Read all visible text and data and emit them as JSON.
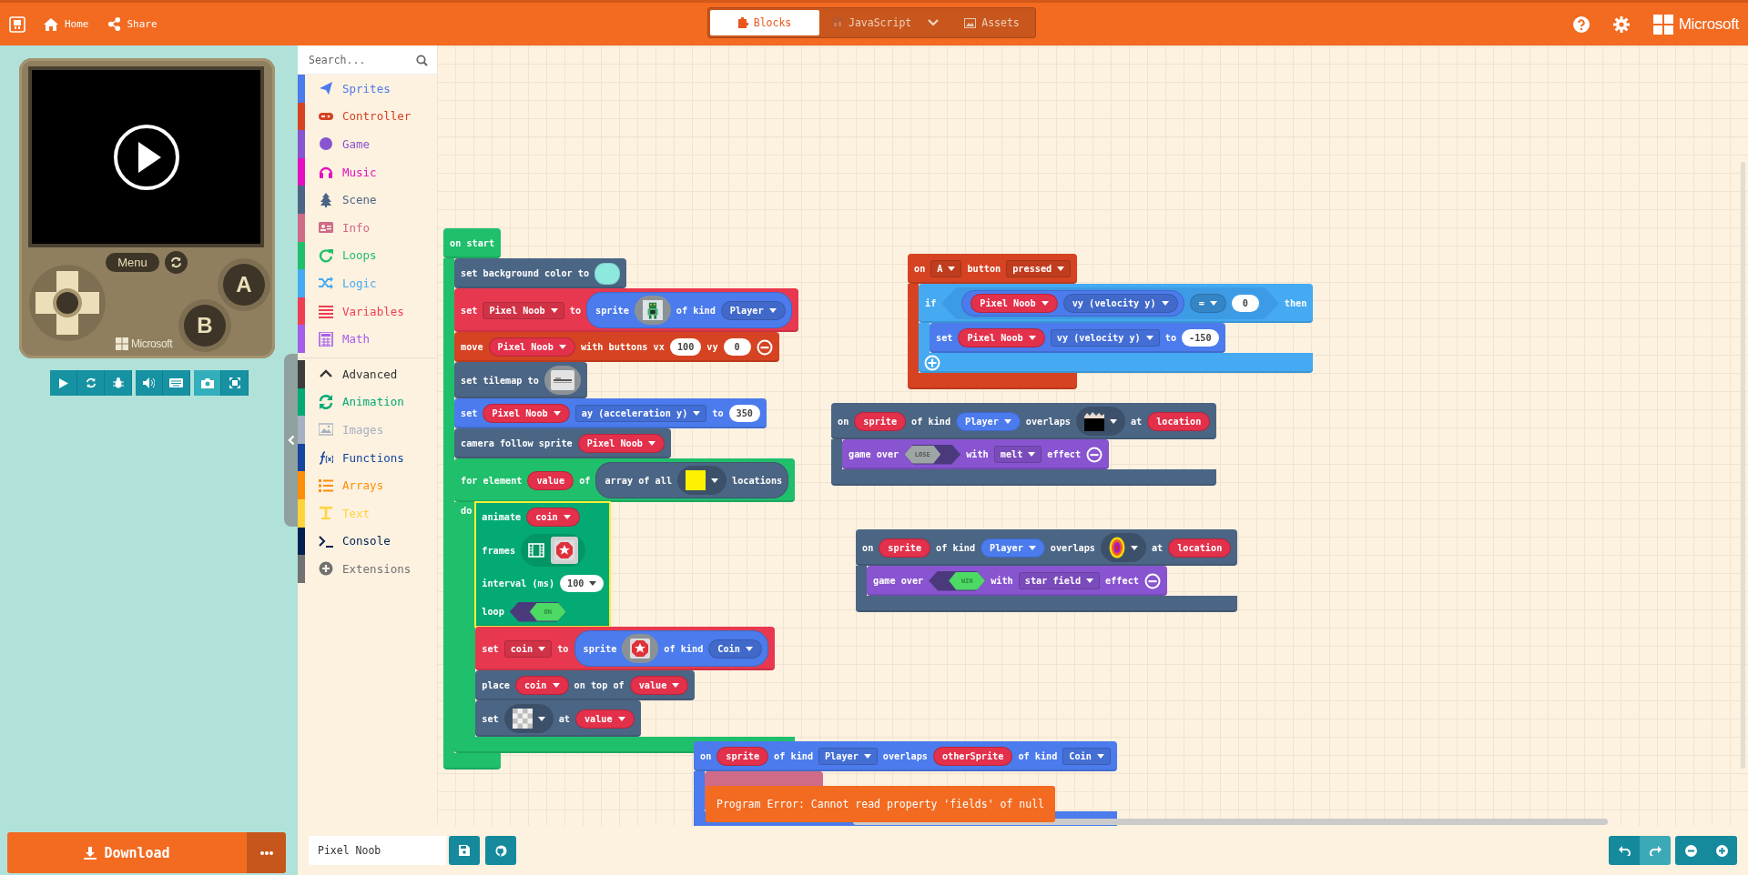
{
  "header": {
    "links": [
      {
        "kind": "home",
        "label": "Home"
      },
      {
        "kind": "share",
        "label": "Share"
      }
    ],
    "tabs": [
      {
        "kind": "blocks",
        "label": "Blocks",
        "selected": true
      },
      {
        "kind": "javascript",
        "label": "JavaScript",
        "selected": false
      },
      {
        "kind": "assets",
        "label": "Assets",
        "selected": false
      }
    ],
    "brand": "Microsoft"
  },
  "simulator": {
    "menu_label": "Menu",
    "buttons": [
      {
        "label": "A"
      },
      {
        "label": "B"
      }
    ],
    "brand": "Microsoft",
    "download_label": "Download"
  },
  "toolbox": {
    "search_placeholder": "Search...",
    "categories": [
      {
        "kind": "sprites",
        "label": "Sprites",
        "color": "#4b7bec"
      },
      {
        "kind": "controller",
        "label": "Controller",
        "color": "#d54322"
      },
      {
        "kind": "game",
        "label": "Game",
        "color": "#8854d0"
      },
      {
        "kind": "music",
        "label": "Music",
        "color": "#e30fc0"
      },
      {
        "kind": "scene",
        "label": "Scene",
        "color": "#4b6584"
      },
      {
        "kind": "info",
        "label": "Info",
        "color": "#cf6a87"
      },
      {
        "kind": "loops",
        "label": "Loops",
        "color": "#20bf6b"
      },
      {
        "kind": "logic",
        "label": "Logic",
        "color": "#45aaf2"
      },
      {
        "kind": "variables",
        "label": "Variables",
        "color": "#ef3e53"
      },
      {
        "kind": "math",
        "label": "Math",
        "color": "#a55eea"
      }
    ],
    "advanced": {
      "label": "Advanced",
      "expanded": true,
      "color": "#3c3c3c"
    },
    "advanced_categories": [
      {
        "kind": "animation",
        "label": "Animation",
        "color": "#03aa74"
      },
      {
        "kind": "images",
        "label": "Images",
        "color": "#a5b1c2"
      },
      {
        "kind": "functions",
        "label": "Functions",
        "color": "#1446a0"
      },
      {
        "kind": "arrays",
        "label": "Arrays",
        "color": "#ff8f08"
      },
      {
        "kind": "text",
        "label": "Text",
        "color": "#ffd43a"
      },
      {
        "kind": "console",
        "label": "Console",
        "color": "#002050"
      },
      {
        "kind": "extensions",
        "label": "Extensions",
        "color": "#717171"
      }
    ]
  },
  "workspace": {
    "stacks": [
      {
        "kind": "loops",
        "selected": false,
        "rows": [
          [
            {
              "kind": "label",
              "text": "on start"
            }
          ]
        ],
        "body": [
          {
            "kind": "scene",
            "selected": false,
            "rows": [
              [
                {
                  "kind": "label",
                  "text": "set background color to"
                },
                {
                  "kind": "color",
                  "color": "#8de8de"
                }
              ]
            ]
          },
          {
            "kind": "variables",
            "selected": false,
            "rows": [
              [
                {
                  "kind": "label",
                  "text": "set"
                },
                {
                  "kind": "field",
                  "text": "Pixel Noob"
                },
                {
                  "kind": "label",
                  "text": "to"
                },
                {
                  "kind": "reporter",
                  "color": "#4b7bec",
                  "parts": [
                    {
                      "kind": "label",
                      "text": "sprite"
                    },
                    {
                      "kind": "robot-image"
                    },
                    {
                      "kind": "label",
                      "text": "of kind"
                    },
                    {
                      "kind": "field",
                      "text": "Player"
                    }
                  ]
                }
              ]
            ]
          },
          {
            "kind": "controller",
            "selected": false,
            "rows": [
              [
                {
                  "kind": "label",
                  "text": "move"
                },
                {
                  "kind": "var",
                  "text": "Pixel Noob"
                },
                {
                  "kind": "label",
                  "text": "with buttons vx"
                },
                {
                  "kind": "num",
                  "text": "100"
                },
                {
                  "kind": "label",
                  "text": "vy"
                },
                {
                  "kind": "num",
                  "text": "0"
                },
                {
                  "kind": "remove"
                }
              ]
            ]
          },
          {
            "kind": "scene",
            "selected": false,
            "rows": [
              [
                {
                  "kind": "label",
                  "text": "set tilemap to"
                },
                {
                  "kind": "tilemap-image"
                }
              ]
            ]
          },
          {
            "kind": "sprites",
            "selected": false,
            "rows": [
              [
                {
                  "kind": "label",
                  "text": "set"
                },
                {
                  "kind": "var",
                  "text": "Pixel Noob"
                },
                {
                  "kind": "field",
                  "text": "ay (acceleration y)"
                },
                {
                  "kind": "label",
                  "text": "to"
                },
                {
                  "kind": "num",
                  "text": "350"
                }
              ]
            ]
          },
          {
            "kind": "scene",
            "selected": false,
            "rows": [
              [
                {
                  "kind": "label",
                  "text": "camera follow sprite"
                },
                {
                  "kind": "var",
                  "text": "Pixel Noob"
                }
              ]
            ]
          },
          {
            "kind": "loops",
            "selected": false,
            "rows": [
              [
                {
                  "kind": "label",
                  "text": "for element"
                },
                {
                  "kind": "arg",
                  "text": "value"
                },
                {
                  "kind": "label",
                  "text": "of"
                },
                {
                  "kind": "reporter",
                  "color": "#4b6584",
                  "parts": [
                    {
                      "kind": "label",
                      "text": "array of all"
                    },
                    {
                      "kind": "yellow-picker"
                    },
                    {
                      "kind": "label",
                      "text": "locations"
                    }
                  ]
                }
              ]
            ],
            "arm_label": "do",
            "body": [
              {
                "kind": "animation",
                "selected": true,
                "rows": [
                  [
                    {
                      "kind": "label",
                      "text": "animate"
                    },
                    {
                      "kind": "var",
                      "text": "coin"
                    }
                  ],
                  [
                    {
                      "kind": "label",
                      "text": "frames"
                    },
                    {
                      "kind": "coin-frames"
                    }
                  ],
                  [
                    {
                      "kind": "label",
                      "text": "interval (ms)"
                    },
                    {
                      "kind": "numdrop",
                      "text": "100"
                    }
                  ],
                  [
                    {
                      "kind": "label",
                      "text": "loop"
                    },
                    {
                      "kind": "toggle",
                      "text": "ON",
                      "on": true
                    }
                  ]
                ]
              },
              {
                "kind": "variables",
                "selected": false,
                "rows": [
                  [
                    {
                      "kind": "label",
                      "text": "set"
                    },
                    {
                      "kind": "field",
                      "text": "coin"
                    },
                    {
                      "kind": "label",
                      "text": "to"
                    },
                    {
                      "kind": "reporter",
                      "color": "#4b7bec",
                      "parts": [
                        {
                          "kind": "label",
                          "text": "sprite"
                        },
                        {
                          "kind": "coin-image"
                        },
                        {
                          "kind": "label",
                          "text": "of kind"
                        },
                        {
                          "kind": "field",
                          "text": "Coin"
                        }
                      ]
                    }
                  ]
                ]
              },
              {
                "kind": "scene",
                "selected": false,
                "rows": [
                  [
                    {
                      "kind": "label",
                      "text": "place"
                    },
                    {
                      "kind": "var",
                      "text": "coin"
                    },
                    {
                      "kind": "label",
                      "text": "on top of"
                    },
                    {
                      "kind": "var",
                      "text": "value"
                    }
                  ]
                ]
              },
              {
                "kind": "scene",
                "selected": false,
                "rows": [
                  [
                    {
                      "kind": "label",
                      "text": "set"
                    },
                    {
                      "kind": "checker-picker"
                    },
                    {
                      "kind": "label",
                      "text": "at"
                    },
                    {
                      "kind": "var",
                      "text": "value"
                    }
                  ]
                ]
              }
            ]
          }
        ]
      },
      {
        "kind": "controller",
        "selected": false,
        "rows": [
          [
            {
              "kind": "label",
              "text": "on"
            },
            {
              "kind": "field",
              "text": "A"
            },
            {
              "kind": "label",
              "text": "button"
            },
            {
              "kind": "field",
              "text": "pressed"
            }
          ]
        ],
        "body": [
          {
            "kind": "logic",
            "selected": false,
            "rows": [
              [
                {
                  "kind": "label",
                  "text": "if"
                },
                {
                  "kind": "hex",
                  "parts": [
                    {
                      "kind": "reporter",
                      "color": "#4b7bec",
                      "parts": [
                        {
                          "kind": "var",
                          "text": "Pixel Noob"
                        },
                        {
                          "kind": "field",
                          "text": "vy (velocity y)"
                        }
                      ]
                    },
                    {
                      "kind": "field",
                      "text": "="
                    },
                    {
                      "kind": "num",
                      "text": "0"
                    }
                  ]
                },
                {
                  "kind": "label",
                  "text": "then"
                }
              ]
            ],
            "body": [
              {
                "kind": "sprites",
                "selected": false,
                "rows": [
                  [
                    {
                      "kind": "label",
                      "text": "set"
                    },
                    {
                      "kind": "var",
                      "text": "Pixel Noob"
                    },
                    {
                      "kind": "field",
                      "text": "vy (velocity y)"
                    },
                    {
                      "kind": "label",
                      "text": "to"
                    },
                    {
                      "kind": "num",
                      "text": "-150"
                    }
                  ]
                ]
              }
            ],
            "footer": [
              {
                "kind": "add"
              }
            ]
          }
        ]
      },
      {
        "kind": "scene",
        "selected": false,
        "rows": [
          [
            {
              "kind": "label",
              "text": "on"
            },
            {
              "kind": "arg",
              "text": "sprite"
            },
            {
              "kind": "label",
              "text": "of kind"
            },
            {
              "kind": "field",
              "text": "Player",
              "color": "#4b7bec"
            },
            {
              "kind": "label",
              "text": "overlaps"
            },
            {
              "kind": "wall-picker"
            },
            {
              "kind": "label",
              "text": "at"
            },
            {
              "kind": "arg",
              "text": "location"
            }
          ]
        ],
        "body": [
          {
            "kind": "game",
            "selected": false,
            "rows": [
              [
                {
                  "kind": "label",
                  "text": "game over"
                },
                {
                  "kind": "toggle",
                  "text": "LOSE",
                  "on": false
                },
                {
                  "kind": "label",
                  "text": "with"
                },
                {
                  "kind": "field",
                  "text": "melt"
                },
                {
                  "kind": "label",
                  "text": "effect"
                },
                {
                  "kind": "remove"
                }
              ]
            ]
          }
        ]
      },
      {
        "kind": "scene",
        "selected": false,
        "rows": [
          [
            {
              "kind": "label",
              "text": "on"
            },
            {
              "kind": "arg",
              "text": "sprite"
            },
            {
              "kind": "label",
              "text": "of kind"
            },
            {
              "kind": "field",
              "text": "Player",
              "color": "#4b7bec"
            },
            {
              "kind": "label",
              "text": "overlaps"
            },
            {
              "kind": "portal-picker"
            },
            {
              "kind": "label",
              "text": "at"
            },
            {
              "kind": "arg",
              "text": "location"
            }
          ]
        ],
        "body": [
          {
            "kind": "game",
            "selected": false,
            "rows": [
              [
                {
                  "kind": "label",
                  "text": "game over"
                },
                {
                  "kind": "toggle",
                  "text": "WIN",
                  "on": true
                },
                {
                  "kind": "label",
                  "text": "with"
                },
                {
                  "kind": "field",
                  "text": "star field"
                },
                {
                  "kind": "label",
                  "text": "effect"
                },
                {
                  "kind": "remove"
                }
              ]
            ]
          }
        ]
      },
      {
        "kind": "sprites",
        "selected": false,
        "rows": [
          [
            {
              "kind": "label",
              "text": "on"
            },
            {
              "kind": "arg",
              "text": "sprite"
            },
            {
              "kind": "label",
              "text": "of kind"
            },
            {
              "kind": "field",
              "text": "Player"
            },
            {
              "kind": "label",
              "text": "overlaps"
            },
            {
              "kind": "arg",
              "text": "otherSprite"
            },
            {
              "kind": "label",
              "text": "of kind"
            },
            {
              "kind": "field",
              "text": "Coin"
            }
          ]
        ],
        "body": [
          {
            "kind": "info",
            "selected": false
          }
        ]
      }
    ],
    "toast": "Program Error: Cannot read property 'fields' of null"
  },
  "bottom_bar": {
    "project_name": "Pixel Noob"
  }
}
